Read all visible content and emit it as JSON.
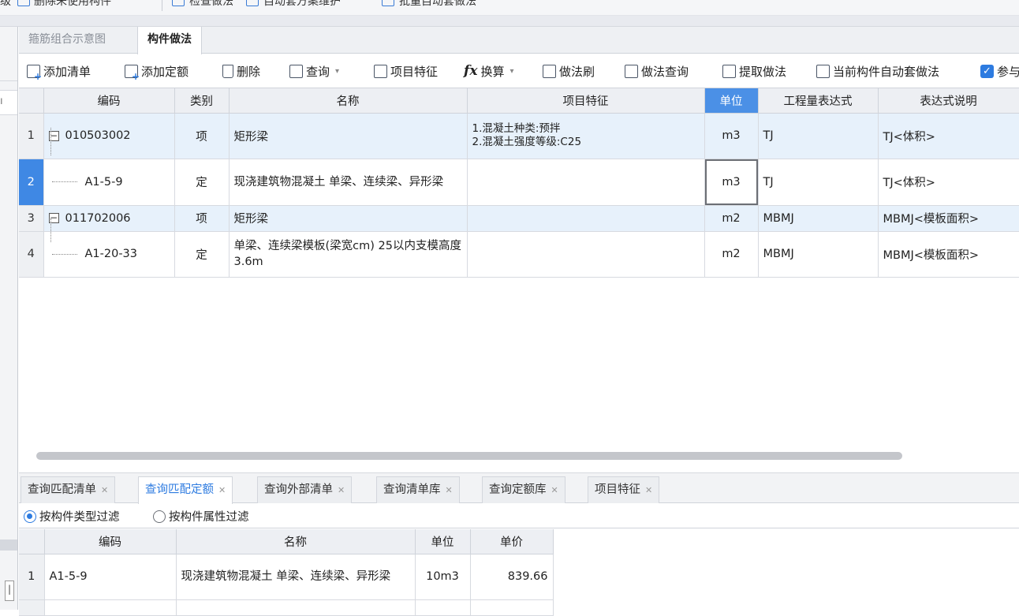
{
  "top_toolbar": {
    "items": [
      "级",
      "删除未使用构件",
      "检查做法",
      "自动套方案维护",
      "批量自动套做法"
    ]
  },
  "tabs": [
    {
      "label": "箍筋组合示意图",
      "active": false
    },
    {
      "label": "构件做法",
      "active": true
    }
  ],
  "toolbar": {
    "add_list": "添加清单",
    "add_quota": "添加定额",
    "delete": "删除",
    "query": "查询",
    "item_feature": "项目特征",
    "convert": "换算",
    "method_brush": "做法刷",
    "method_query": "做法查询",
    "extract_method": "提取做法",
    "auto_apply": "当前构件自动套做法",
    "reference": "参与"
  },
  "main_table": {
    "columns": [
      "编码",
      "类别",
      "名称",
      "项目特征",
      "单位",
      "工程量表达式",
      "表达式说明"
    ],
    "rows": [
      {
        "num": "1",
        "code": "010503002",
        "type": "项",
        "name": "矩形梁",
        "feature": "1.混凝土种类:预拌\n2.混凝土强度等级:C25",
        "unit": "m3",
        "expr": "TJ",
        "desc": "TJ<体积>"
      },
      {
        "num": "2",
        "code": "A1-5-9",
        "type": "定",
        "name": "现浇建筑物混凝土 单梁、连续梁、异形梁",
        "feature": "",
        "unit": "m3",
        "expr": "TJ",
        "desc": "TJ<体积>"
      },
      {
        "num": "3",
        "code": "011702006",
        "type": "项",
        "name": "矩形梁",
        "feature": "",
        "unit": "m2",
        "expr": "MBMJ",
        "desc": "MBMJ<模板面积>"
      },
      {
        "num": "4",
        "code": "A1-20-33",
        "type": "定",
        "name": "单梁、连续梁模板(梁宽cm) 25以内支模高度3.6m",
        "feature": "",
        "unit": "m2",
        "expr": "MBMJ",
        "desc": "MBMJ<模板面积>"
      }
    ]
  },
  "bottom_tabs": [
    {
      "label": "查询匹配清单",
      "active": false
    },
    {
      "label": "查询匹配定额",
      "active": true
    },
    {
      "label": "查询外部清单",
      "active": false
    },
    {
      "label": "查询清单库",
      "active": false
    },
    {
      "label": "查询定额库",
      "active": false
    },
    {
      "label": "项目特征",
      "active": false
    }
  ],
  "filters": {
    "by_type": "按构件类型过滤",
    "by_attr": "按构件属性过滤",
    "selected": "by_type"
  },
  "bottom_table": {
    "columns": [
      "编码",
      "名称",
      "单位",
      "单价"
    ],
    "rows": [
      {
        "num": "1",
        "code": "A1-5-9",
        "name": "现浇建筑物混凝土 单梁、连续梁、异形梁",
        "unit": "10m3",
        "price": "839.66"
      }
    ]
  },
  "colors": {
    "accent": "#2d7be0",
    "selected_header": "#4b90e6",
    "row_highlight": "#e7f1fb"
  }
}
